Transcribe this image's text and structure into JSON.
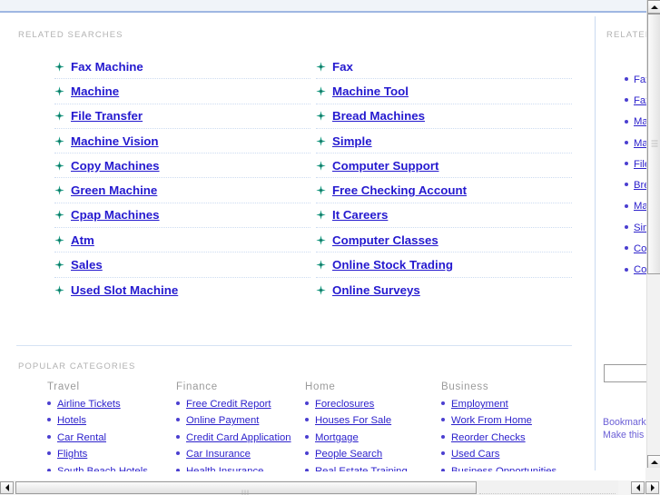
{
  "page": {
    "related_searches_label": "RELATED SEARCHES",
    "popular_categories_label": "POPULAR CATEGORIES",
    "bullet_icon": "green-sparkle-icon",
    "accent_link_color": "#2419cf",
    "label_color": "#b2b2b2",
    "divider_color": "#d6e3f4",
    "banner_bg_color": "#f0f4f9",
    "banner_border_color": "#9fb7e2"
  },
  "related_searches": {
    "left_column": [
      {
        "label": "Fax Machine",
        "underlined": false
      },
      {
        "label": "Machine",
        "underlined": true
      },
      {
        "label": "File Transfer",
        "underlined": true
      },
      {
        "label": "Machine Vision",
        "underlined": true
      },
      {
        "label": "Copy Machines",
        "underlined": true
      },
      {
        "label": "Green Machine",
        "underlined": true
      },
      {
        "label": "Cpap Machines",
        "underlined": true
      },
      {
        "label": "Atm",
        "underlined": true
      },
      {
        "label": "Sales",
        "underlined": true
      },
      {
        "label": "Used Slot Machine",
        "underlined": true
      }
    ],
    "right_column": [
      {
        "label": "Fax",
        "underlined": false
      },
      {
        "label": "Machine Tool",
        "underlined": true
      },
      {
        "label": "Bread Machines",
        "underlined": true
      },
      {
        "label": "Simple",
        "underlined": true
      },
      {
        "label": "Computer Support",
        "underlined": true
      },
      {
        "label": "Free Checking Account",
        "underlined": true
      },
      {
        "label": "It Careers",
        "underlined": true
      },
      {
        "label": "Computer Classes",
        "underlined": true
      },
      {
        "label": "Online Stock Trading",
        "underlined": true
      },
      {
        "label": "Online Surveys",
        "underlined": true
      }
    ]
  },
  "popular_categories": {
    "columns": [
      {
        "title": "Travel",
        "items": [
          "Airline Tickets",
          "Hotels",
          "Car Rental",
          "Flights",
          "South Beach Hotels"
        ]
      },
      {
        "title": "Finance",
        "items": [
          "Free Credit Report",
          "Online Payment",
          "Credit Card Application",
          "Car Insurance",
          "Health Insurance"
        ]
      },
      {
        "title": "Home",
        "items": [
          "Foreclosures",
          "Houses For Sale",
          "Mortgage",
          "People Search",
          "Real Estate Training"
        ]
      },
      {
        "title": "Business",
        "items": [
          "Employment",
          "Work From Home",
          "Reorder Checks",
          "Used Cars",
          "Business Opportunities"
        ]
      }
    ]
  },
  "right_panel": {
    "related_label": "RELATED",
    "items": [
      {
        "label": "Fax Machine",
        "underlined": false
      },
      {
        "label": "Fax",
        "underlined": true
      },
      {
        "label": "Machine",
        "underlined": true
      },
      {
        "label": "Machine Tool",
        "underlined": true
      },
      {
        "label": "File Transfer",
        "underlined": true
      },
      {
        "label": "Bread Machines",
        "underlined": true
      },
      {
        "label": "Machine Vision",
        "underlined": true
      },
      {
        "label": "Simple",
        "underlined": true
      },
      {
        "label": "Copy Machines",
        "underlined": true
      },
      {
        "label": "Computer Support",
        "underlined": true
      }
    ],
    "search_value": "",
    "search_placeholder": "",
    "footer_links": [
      "Bookmark this page",
      "Make this my homepage"
    ]
  }
}
